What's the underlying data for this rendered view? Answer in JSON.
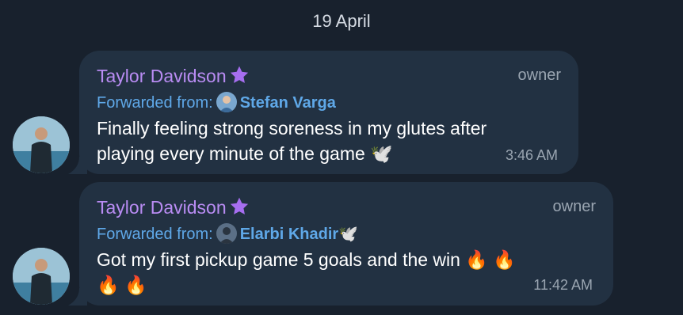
{
  "date_separator": "19 April",
  "messages": [
    {
      "sender": "Taylor Davidson",
      "role": "owner",
      "forwarded_label": "Forwarded from:",
      "forwarded_name": "Stefan Varga",
      "text_line1": "Finally feeling strong soreness in my glutes after",
      "text_line2": "playing every minute of the game 🕊️",
      "time": "3:46 AM"
    },
    {
      "sender": "Taylor Davidson",
      "role": "owner",
      "forwarded_label": "Forwarded from:",
      "forwarded_name": "Elarbi Khadir🕊️",
      "text_line1": "Got my first pickup game 5 goals and the win 🔥 🔥",
      "text_line2": "🔥 🔥",
      "time": "11:42 AM"
    }
  ],
  "colors": {
    "background": "#18212d",
    "bubble": "#223142",
    "sender": "#b98cf3",
    "link": "#5fa8e8",
    "muted": "#9aa5b1"
  }
}
